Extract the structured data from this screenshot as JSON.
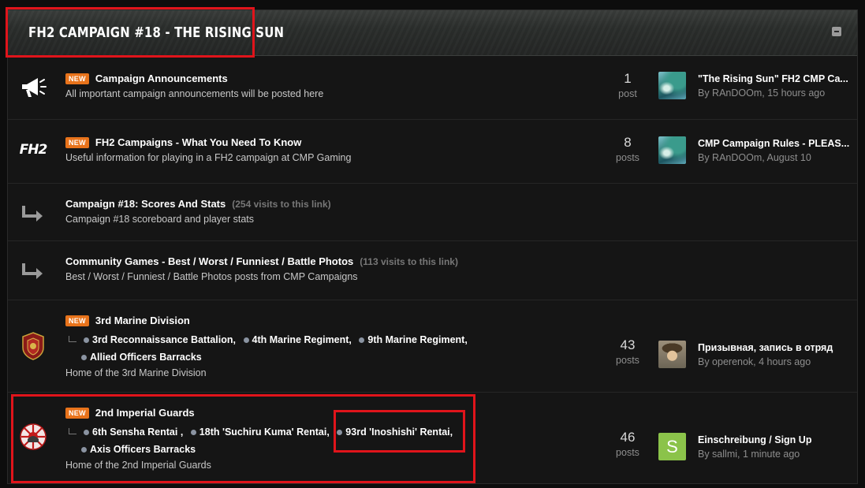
{
  "category": {
    "title": "FH2 CAMPAIGN #18 - THE RISING SUN"
  },
  "badge_new": "NEW",
  "forums": [
    {
      "icon": "megaphone-icon",
      "title": "Campaign Announcements",
      "desc": "All important campaign announcements will be posted here",
      "count": "1",
      "count_label": "post",
      "last_title": "\"The Rising Sun\" FH2 CMP Ca...",
      "last_meta": "By RAnDOOm, 15 hours ago"
    },
    {
      "icon": "fh2-logo-icon",
      "icon_text": "FH2",
      "title": "FH2 Campaigns - What You Need To Know",
      "desc": "Useful information for playing in a FH2 campaign at CMP Gaming",
      "count": "8",
      "count_label": "posts",
      "last_title": "CMP Campaign Rules - PLEAS...",
      "last_meta": "By RAnDOOm, August 10"
    },
    {
      "icon": "redirect-arrow-icon",
      "title": "Campaign #18: Scores And Stats",
      "visits": "(254 visits to this link)",
      "desc": "Campaign #18 scoreboard and player stats"
    },
    {
      "icon": "redirect-arrow-icon",
      "title": "Community Games - Best / Worst / Funniest / Battle Photos",
      "visits": "(113 visits to this link)",
      "desc": "Best / Worst / Funniest / Battle Photos posts from CMP Campaigns"
    },
    {
      "icon": "marine-division-emblem-icon",
      "title": "3rd Marine Division",
      "subforums": [
        "3rd Reconnaissance Battalion,",
        "4th Marine Regiment,",
        "9th Marine Regiment,",
        "Allied Officers Barracks"
      ],
      "desc": "Home of the 3rd Marine Division",
      "count": "43",
      "count_label": "posts",
      "last_title": "Призывная, запись в отряд",
      "last_meta": "By operenok, 4 hours ago"
    },
    {
      "icon": "imperial-guards-emblem-icon",
      "title": "2nd Imperial Guards",
      "subforums": [
        "6th Sensha Rentai ,",
        "18th 'Suchiru Kuma' Rentai,",
        "93rd 'Inoshishi' Rentai,",
        "Axis Officers Barracks"
      ],
      "desc": "Home of the 2nd Imperial Guards",
      "count": "46",
      "count_label": "posts",
      "last_avatar_letter": "S",
      "last_title": "Einschreibung / Sign Up",
      "last_meta": "By sallmi, 1 minute ago"
    }
  ],
  "colors": {
    "background": "#151515",
    "badge": "#e8731b",
    "highlight_box": "#e0141b",
    "avatar_green": "#8bc34a"
  }
}
